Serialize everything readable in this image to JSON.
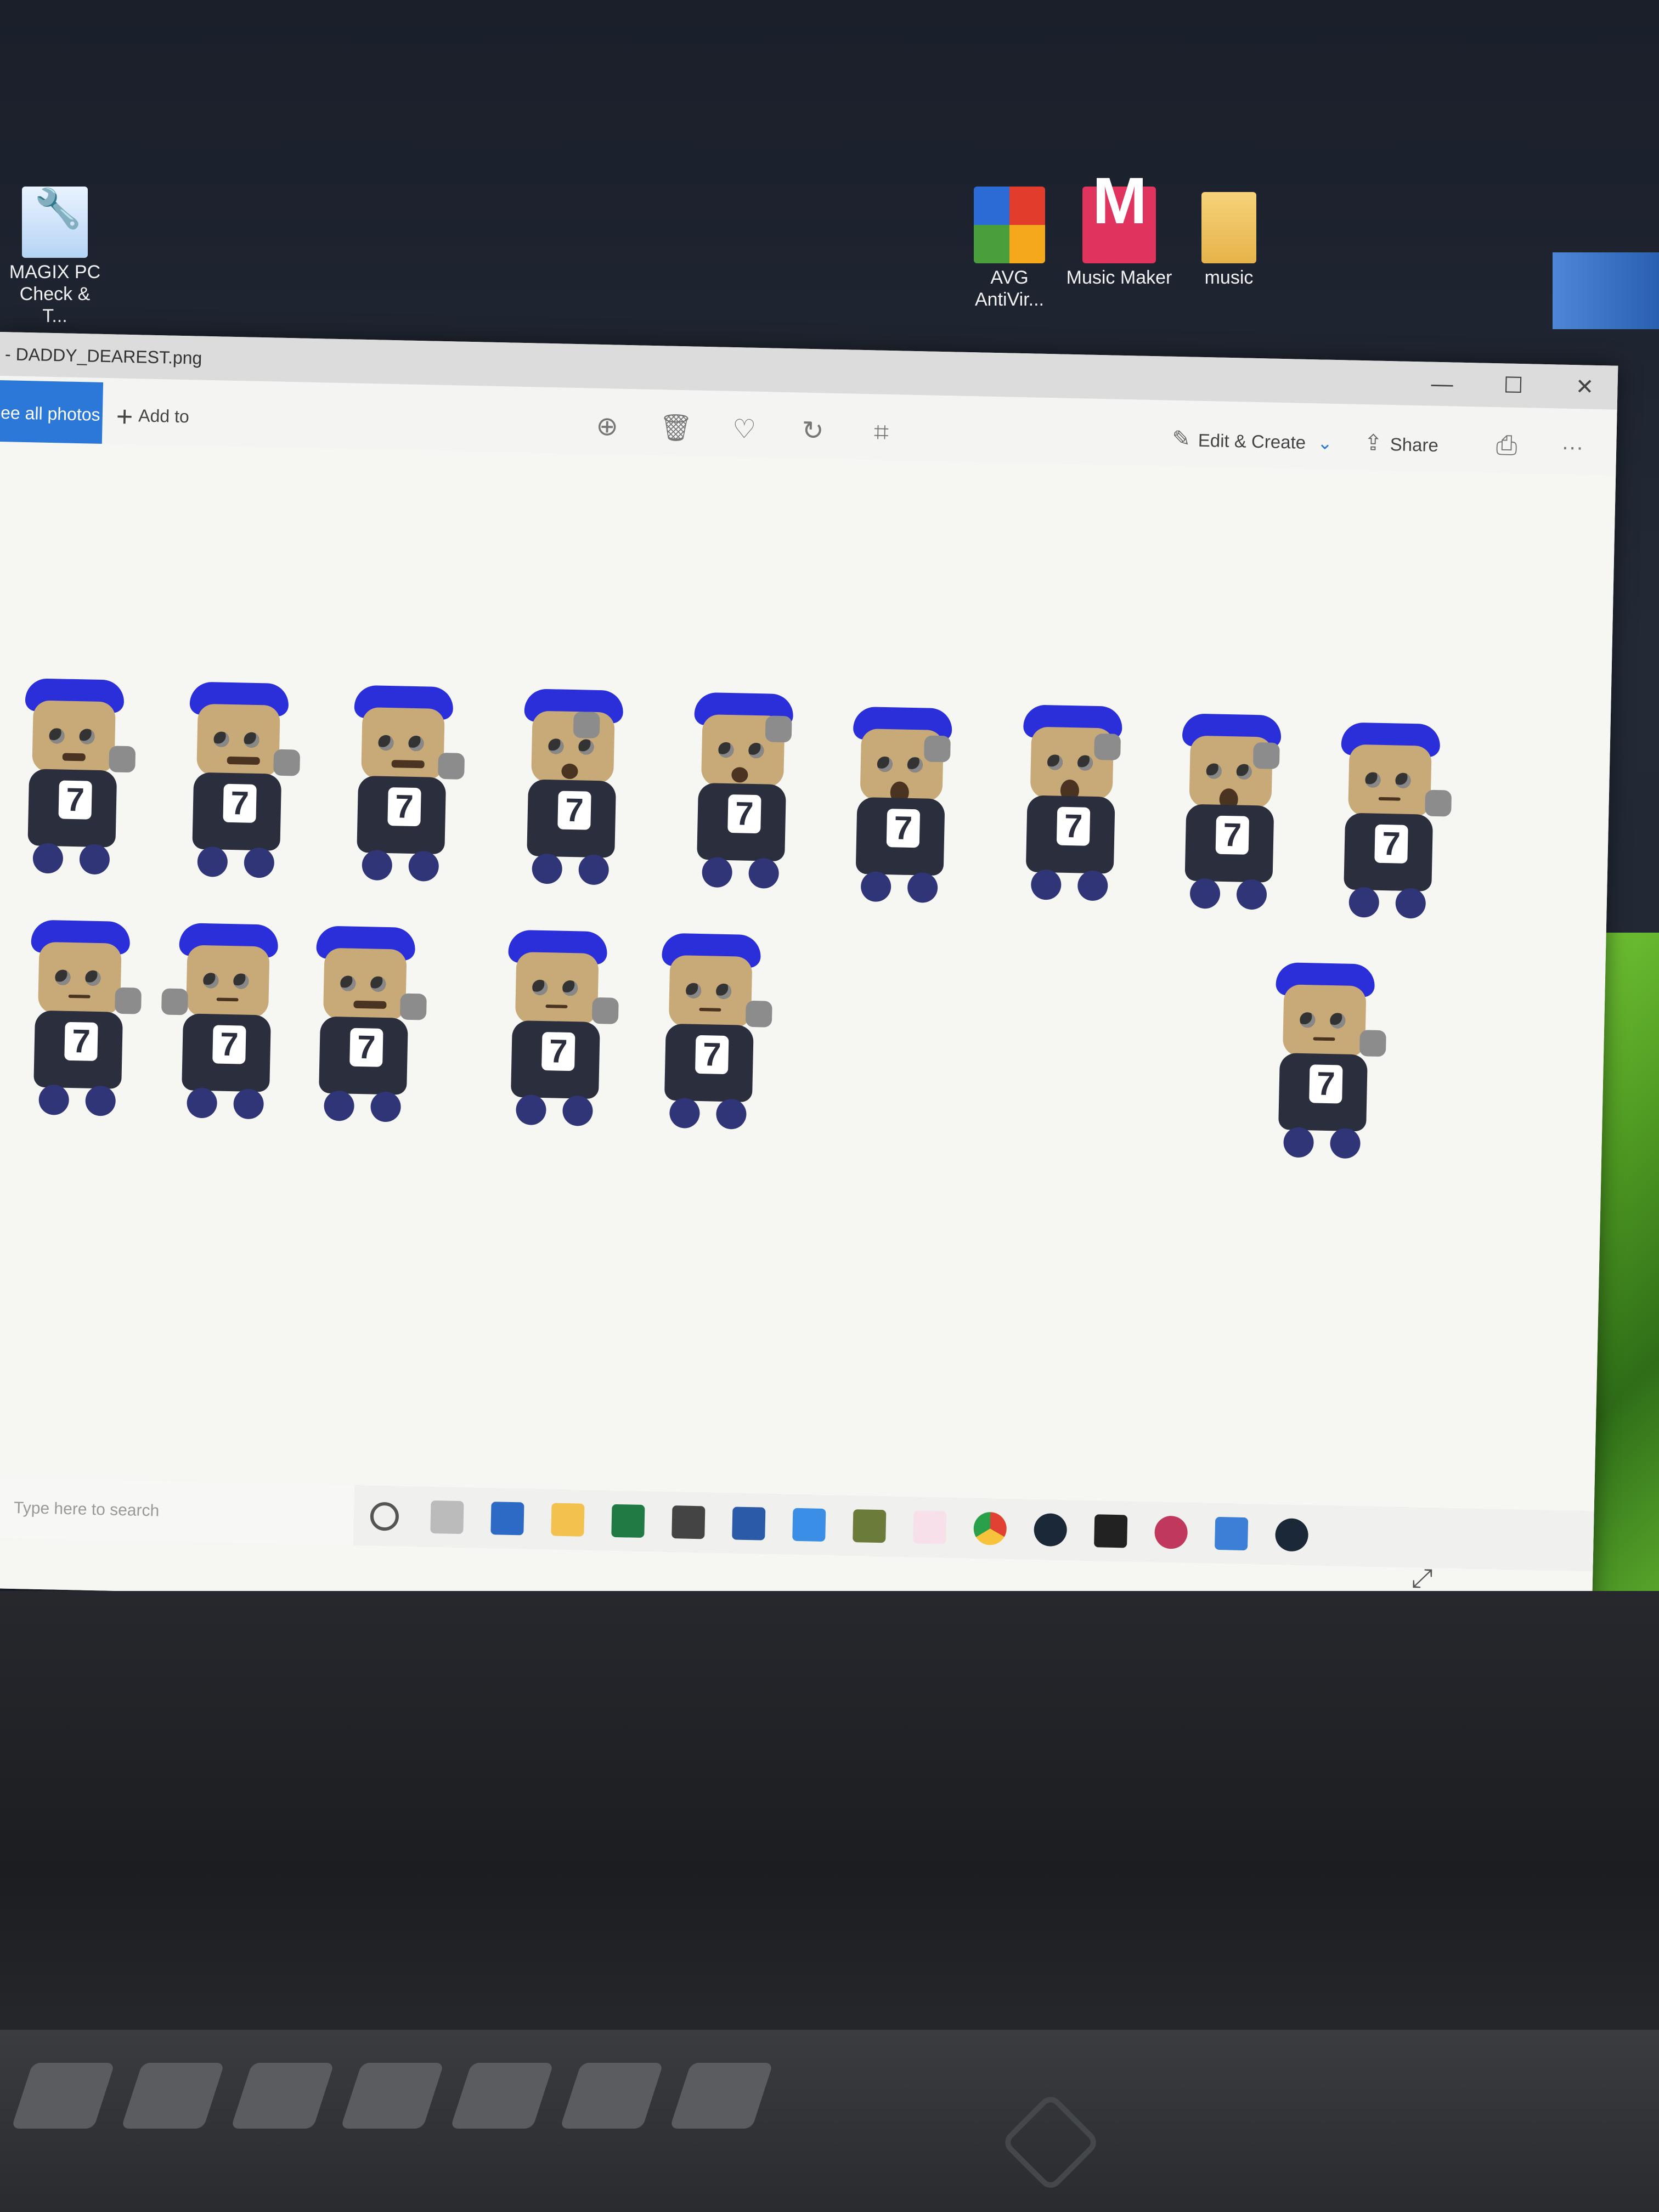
{
  "desktop": {
    "icons": [
      {
        "label": "MAGIX PC Check & T...",
        "icon": "wrench-icon"
      },
      {
        "label": "AVG AntiVir...",
        "icon": "avg-icon"
      },
      {
        "label": "Music Maker",
        "icon": "music-maker-icon",
        "glyph": "M"
      },
      {
        "label": "music",
        "icon": "folder-icon"
      }
    ]
  },
  "window": {
    "title": "- DADDY_DEAREST.png",
    "controls": {
      "minimize": "—",
      "maximize": "☐",
      "close": "✕"
    },
    "toolbar": {
      "see_all": "ee all photos",
      "add_to": "Add to",
      "edit_create": "Edit & Create",
      "share": "Share",
      "more": "···"
    },
    "sprite_number": "7"
  },
  "taskbar": {
    "search_placeholder": "Type here to search"
  }
}
